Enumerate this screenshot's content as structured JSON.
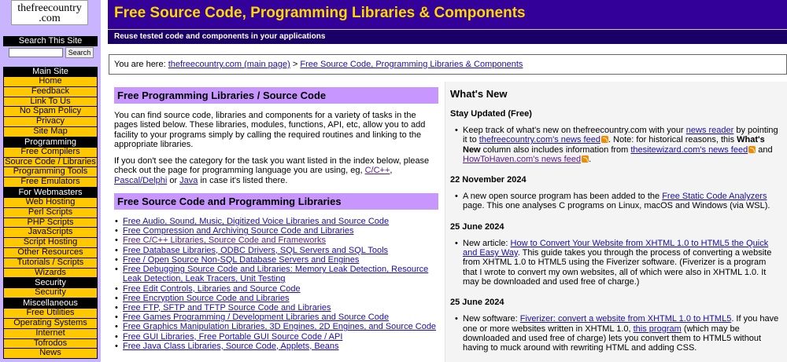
{
  "logo": {
    "line1": "thefreecountry",
    "line2": ".com"
  },
  "search": {
    "title": "Search This Site",
    "placeholder": "",
    "button": "Search"
  },
  "leftnav": [
    {
      "head": "Main Site",
      "items": [
        "Home",
        "Feedback",
        "Link To Us",
        "No Spam Policy",
        "Privacy",
        "Site Map"
      ]
    },
    {
      "head": "Programming",
      "items": [
        "Free Compilers",
        "Source Code / Libraries",
        "Programming Tools",
        "Free Emulators"
      ]
    },
    {
      "head": "For Webmasters",
      "items": [
        "Web Hosting",
        "Perl Scripts",
        "PHP Scripts",
        "JavaScripts",
        "Script Hosting",
        "Other Resources",
        "Tutorials / Scripts",
        "Wizards"
      ]
    },
    {
      "head": "Security",
      "items": [
        "Security"
      ]
    },
    {
      "head": "Miscellaneous",
      "items": [
        "Free Utilities",
        "Operating Systems",
        "Internet",
        "Tofrodos",
        "News"
      ]
    }
  ],
  "header": {
    "title": "Free Source Code, Programming Libraries & Components",
    "tagline": "Reuse tested code and components in your applications"
  },
  "breadcrumb": {
    "prefix": "You are here: ",
    "home": "thefreecountry.com (main page)",
    "sep": " > ",
    "current": "Free Source Code, Programming Libraries & Components"
  },
  "main": {
    "section1_title": "Free Programming Libraries / Source Code",
    "intro": "You can find source code, libraries and components for a variety of tasks in the pages listed below. These libraries, modules, functions, API, etc, allow you to add facility to your programs simply by calling the required routines and linking to the appropriate libraries.",
    "para2_a": "If you don't see the category for the task you want listed in the index below, please check out the page for programming language you are using, eg, ",
    "lang_c": "C/C++",
    "comma": ", ",
    "lang_pascal": "Pascal/Delphi",
    "or": " or ",
    "lang_java": "Java",
    "para2_b": " in case it's listed there.",
    "section2_title": "Free Source Code and Programming Libraries",
    "libs": [
      "Free Audio, Sound, Music, Digitized Voice Libraries and Source Code",
      "Free Compression and Archiving Source Code and Libraries",
      "Free C/C++ Libraries, Source Code and Frameworks",
      "Free Database Libraries, ODBC Drivers, SQL Servers and SQL Tools",
      "Free / Open Source Non-SQL Database Servers and Engines",
      "Free Debugging Source Code and Libraries: Memory Leak Detection, Resource Leak Detection, Leak Tracers, Unit Testing",
      "Free Edit Controls, Libraries and Source Code",
      "Free Encryption Source Code and Libraries",
      "Free FTP, SFTP and TFTP Source Code and Libraries",
      "Free Games Programming / Development Libraries and Source Code",
      "Free Graphics Manipulation Libraries, 3D Engines, 2D Engines, and Source Code",
      "Free GUI Libraries, Free Portable GUI Source Code / API",
      "Free Java Class Libraries, Source Code, Applets, Beans"
    ]
  },
  "whatsnew": {
    "title": "What's New",
    "stay_title": "Stay Updated (Free)",
    "stay_a": "Keep track of what's new on thefreecountry.com with your ",
    "stay_news_reader": "news reader",
    "stay_b": " by pointing it to ",
    "stay_feed_link": "thefreecountry.com's news feed",
    "stay_c": ". Note: for historical reasons, this ",
    "stay_bold": "What's New",
    "stay_d": " column also includes information from ",
    "stay_wiz_link": "thesitewizard.com's news feed",
    "stay_e": " and ",
    "stay_how_link": "HowToHaven.com's news feed",
    "stay_f": ".",
    "date1": "22 November 2024",
    "item1_a": "A new open source program has been added to the ",
    "item1_link": "Free Static Code Analyzers",
    "item1_b": " page. This one analyses C programs on Linux, macOS and Windows (via WSL).",
    "date2": "25 June 2024",
    "item2_a": "New article: ",
    "item2_link": "How to Convert Your Website from XHTML 1.0 to HTML5 the Quick and Easy Way",
    "item2_b": ". This guide takes you through the process of converting a website from XHTML 1.0 to HTML5 using the Fiverizer software. (Fiverizer is a program that I wrote to convert my own websites, all of which were also in XHTML 1.0. It may be downloaded and used free of charge.)",
    "date3": "25 June 2024",
    "item3_a": "New software: ",
    "item3_link1": "Fiverizer: convert a website from XHTML 1.0 to HTML5",
    "item3_b": ". If you have one or more websites written in XHTML 1.0, ",
    "item3_link2": "this program",
    "item3_c": " (which may be downloaded and used free of charge) lets you convert them to HTML5 without having to muck around with rewriting HTML and adding CSS."
  },
  "colors": {
    "header_bg": "#330099",
    "title": "#ffd700",
    "nav_item": "#ffc800",
    "section_head": "#c896ff",
    "leftcol": "#c8b4ff"
  }
}
